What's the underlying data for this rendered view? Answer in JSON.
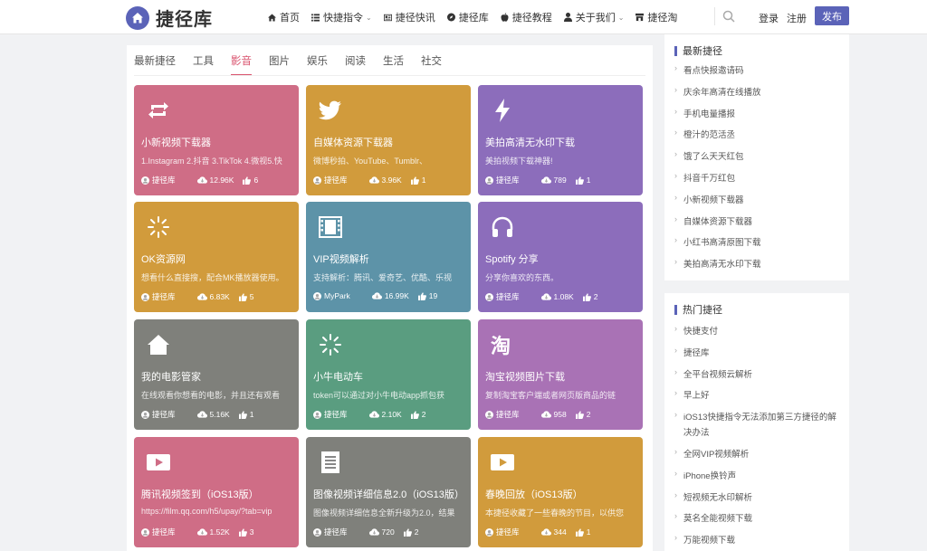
{
  "brand": {
    "name": "捷径库",
    "accent": "#5b63b8"
  },
  "nav": [
    {
      "label": "首页",
      "icon": "home-icon",
      "caret": false
    },
    {
      "label": "快捷指令",
      "icon": "list-icon",
      "caret": true
    },
    {
      "label": "捷径快讯",
      "icon": "news-icon",
      "caret": false
    },
    {
      "label": "捷径库",
      "icon": "compass-icon",
      "caret": false
    },
    {
      "label": "捷径教程",
      "icon": "apple-icon",
      "caret": false
    },
    {
      "label": "关于我们",
      "icon": "user-icon",
      "caret": true
    },
    {
      "label": "捷径淘",
      "icon": "shop-icon",
      "caret": false
    }
  ],
  "header": {
    "login": "登录",
    "register": "注册",
    "publish": "发布"
  },
  "tabs": [
    {
      "label": "最新捷径",
      "active": false
    },
    {
      "label": "工具",
      "active": false
    },
    {
      "label": "影音",
      "active": true
    },
    {
      "label": "图片",
      "active": false
    },
    {
      "label": "娱乐",
      "active": false
    },
    {
      "label": "阅读",
      "active": false
    },
    {
      "label": "生活",
      "active": false
    },
    {
      "label": "社交",
      "active": false
    }
  ],
  "cards": [
    {
      "title": "小新视频下载器",
      "desc": "1.Instagram 2.抖音 3.TikTok 4.微视5.快",
      "author": "捷径库",
      "views": "12.96K",
      "likes": "6",
      "color": "#cf6d86",
      "icon": "repeat-icon"
    },
    {
      "title": "自媒体资源下载器",
      "desc": "微博秒拍、YouTube、Tumblr、",
      "author": "捷径库",
      "views": "3.96K",
      "likes": "1",
      "color": "#d19b3c",
      "icon": "twitter-icon"
    },
    {
      "title": "美拍高清无水印下载",
      "desc": "美拍视频下载神器!",
      "author": "捷径库",
      "views": "789",
      "likes": "1",
      "color": "#8c6dbb",
      "icon": "bolt-icon"
    },
    {
      "title": "OK资源网",
      "desc": "想看什么直接搜，配合MK播放器使用。",
      "author": "捷径库",
      "views": "6.83K",
      "likes": "5",
      "color": "#d19b3c",
      "icon": "magic-icon"
    },
    {
      "title": "VIP视频解析",
      "desc": "支持解析：腾讯、爱奇艺、优酷、乐视",
      "author": "MyPark",
      "views": "16.99K",
      "likes": "19",
      "color": "#5d93a8",
      "icon": "film-icon"
    },
    {
      "title": "Spotify 分享",
      "desc": "分享你喜欢的东西。",
      "author": "捷径库",
      "views": "1.08K",
      "likes": "2",
      "color": "#8c6dbb",
      "icon": "headphones-icon"
    },
    {
      "title": "我的电影管家",
      "desc": "在线观看你想看的电影，并且还有观看",
      "author": "捷径库",
      "views": "5.16K",
      "likes": "1",
      "color": "#7f807b",
      "icon": "home-icon"
    },
    {
      "title": "小牛电动车",
      "desc": "token可以通过对小牛电动app抓包获",
      "author": "捷径库",
      "views": "2.10K",
      "likes": "2",
      "color": "#5a9d80",
      "icon": "magic-icon"
    },
    {
      "title": "淘宝视频图片下载",
      "desc": "复制淘宝客户端或者网页版商品的链",
      "author": "捷径库",
      "views": "958",
      "likes": "2",
      "color": "#a972b5",
      "icon": "taobao-icon",
      "icon_text": "淘"
    },
    {
      "title": "腾讯视频签到（iOS13版）",
      "desc": "https://film.qq.com/h5/upay/?tab=vip",
      "author": "捷径库",
      "views": "1.52K",
      "likes": "3",
      "color": "#cf6d86",
      "icon": "video-icon"
    },
    {
      "title": "图像视频详细信息2.0（iOS13版）",
      "desc": "图像视频详细信息全新升级为2.0，结果",
      "author": "捷径库",
      "views": "720",
      "likes": "2",
      "color": "#7f807b",
      "icon": "document-icon"
    },
    {
      "title": "春晚回放（iOS13版）",
      "desc": "本捷径收藏了一些春晚的节目，以供您",
      "author": "捷径库",
      "views": "344",
      "likes": "1",
      "color": "#d19b3c",
      "icon": "video-icon"
    }
  ],
  "sidebar": {
    "latest": {
      "title": "最新捷径",
      "items": [
        "看点快报邀请码",
        "庆余年高清在线播放",
        "手机电量播报",
        "橙汁的范活丞",
        "饿了么天天红包",
        "抖音千万红包",
        "小新视频下载器",
        "自媒体资源下载器",
        "小红书高清原图下载",
        "美拍高清无水印下载"
      ]
    },
    "hot": {
      "title": "热门捷径",
      "items": [
        "快捷支付",
        "捷径库",
        "全平台视频云解析",
        "早上好",
        "iOS13快捷指令无法添加第三方捷径的解决办法",
        "全网VIP视频解析",
        "iPhone换铃声",
        "短视频无水印解析",
        "莫名全能视频下载",
        "万能视频下载"
      ]
    }
  }
}
